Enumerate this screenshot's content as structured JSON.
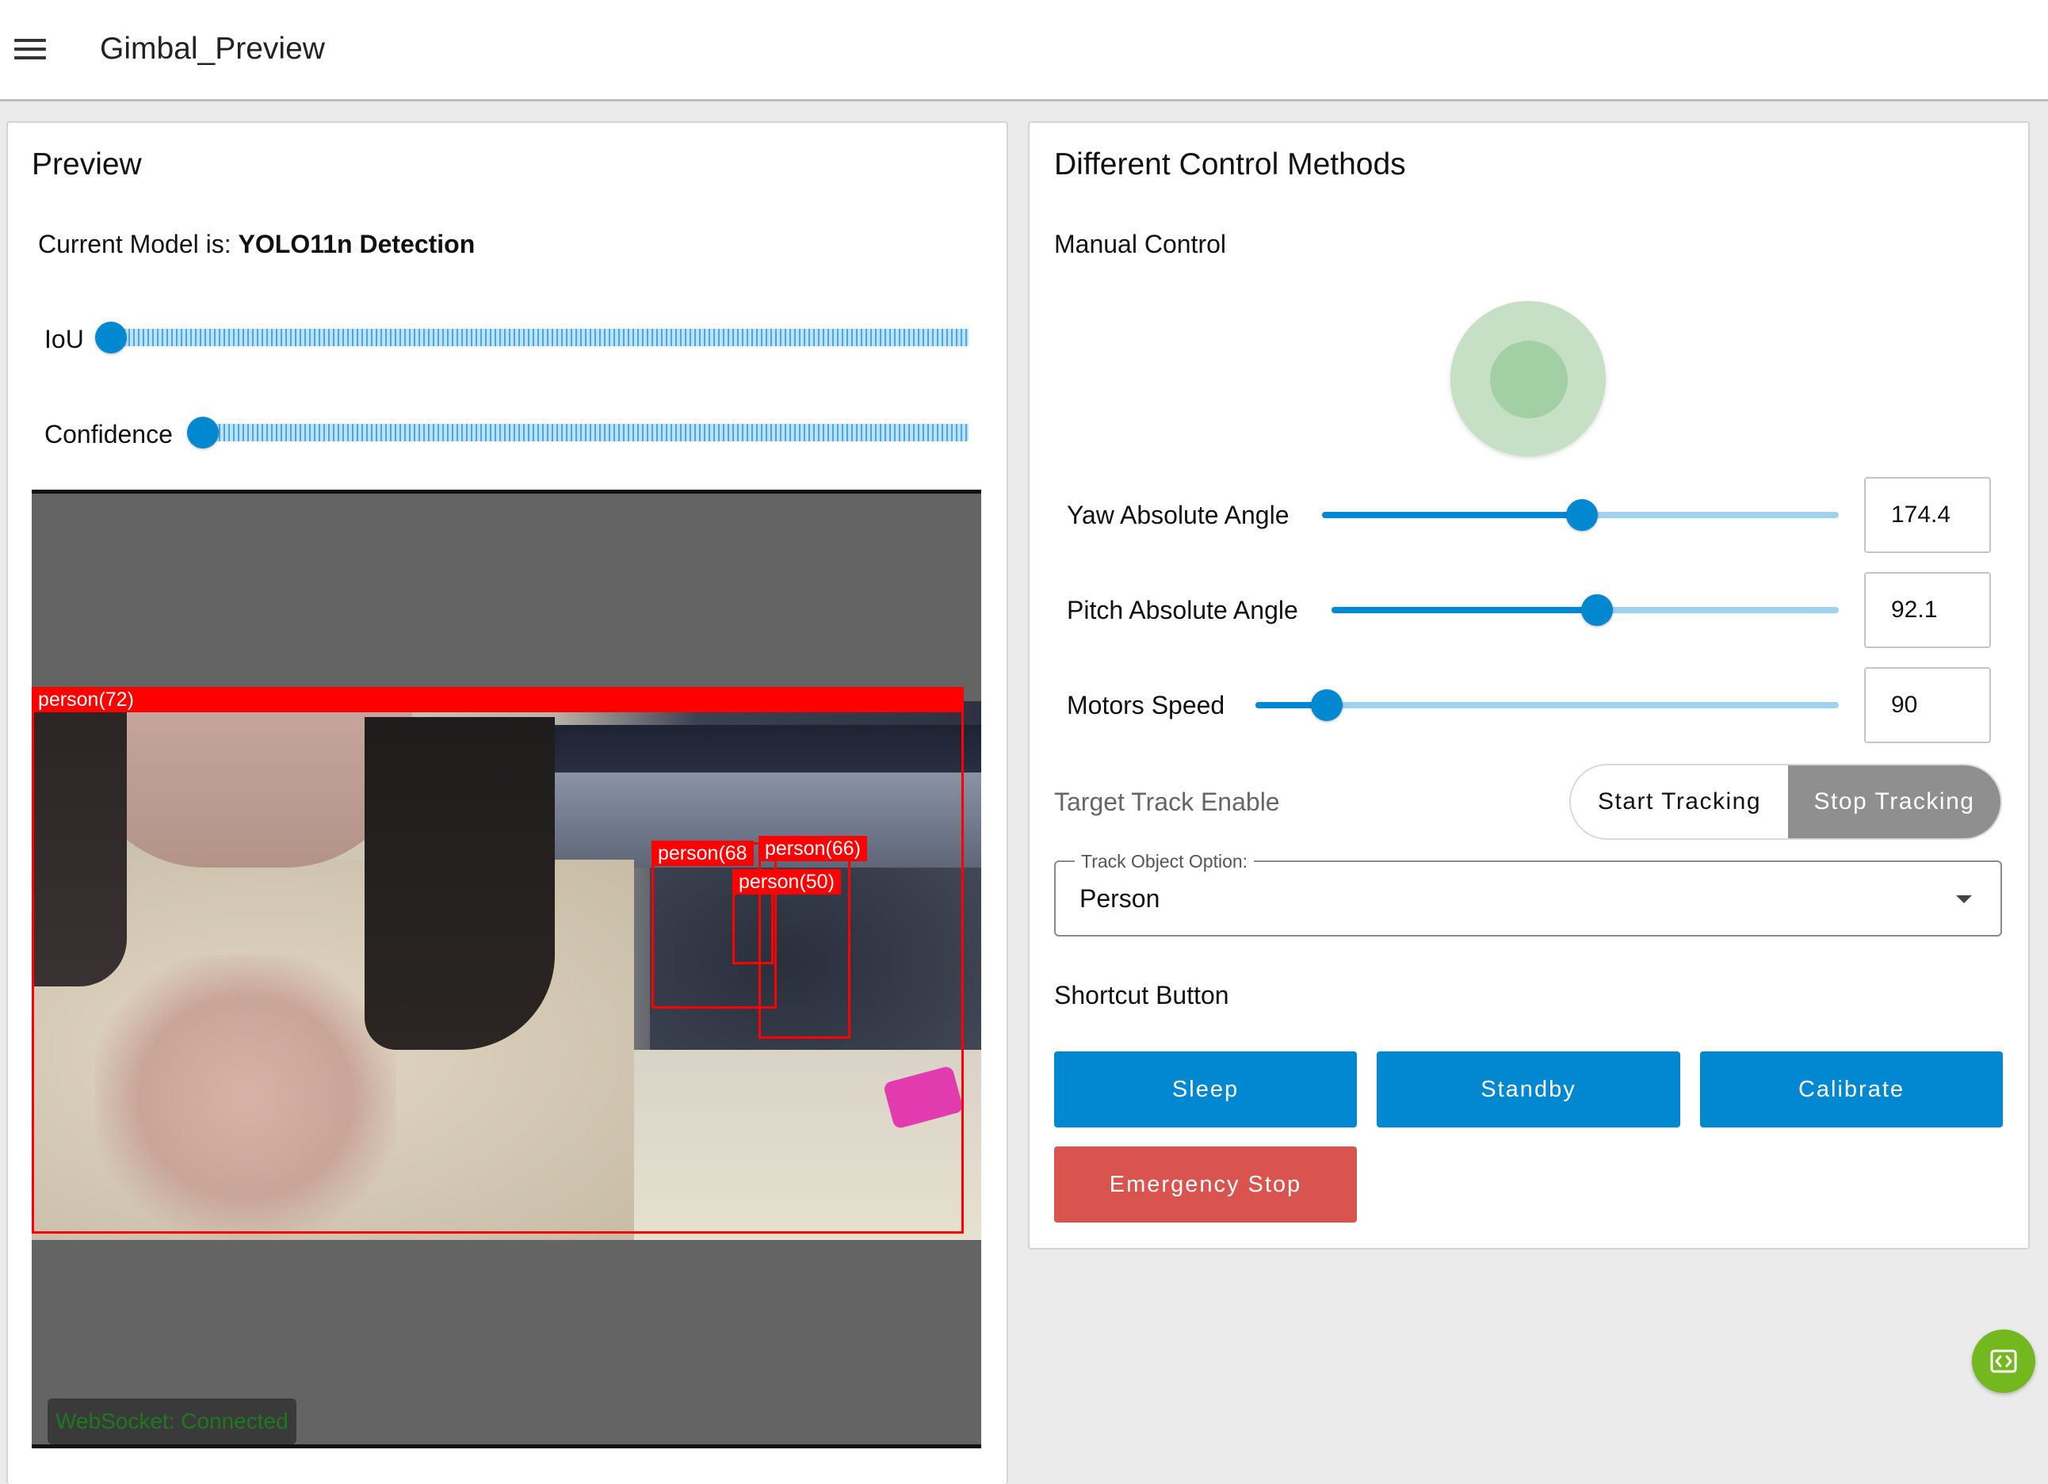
{
  "app": {
    "title": "Gimbal_Preview",
    "menu_icon": "hamburger-menu-icon"
  },
  "preview": {
    "title": "Preview",
    "model_prefix": "Current Model is: ",
    "model_name": "YOLO11n Detection",
    "sliders": [
      {
        "label": "IoU",
        "value_fraction": 0.0
      },
      {
        "label": "Confidence",
        "value_fraction": 0.0
      }
    ],
    "detections": [
      {
        "label": "person(72)"
      },
      {
        "label": "person(68"
      },
      {
        "label": "person(66)"
      },
      {
        "label": "person(50)"
      }
    ],
    "websocket_status": "WebSocket: Connected"
  },
  "control": {
    "title": "Different Control Methods",
    "manual_label": "Manual Control",
    "sliders": [
      {
        "label": "Yaw Absolute Angle",
        "value": "174.4",
        "fraction": 0.5
      },
      {
        "label": "Pitch Absolute Angle",
        "value": "92.1",
        "fraction": 0.52
      },
      {
        "label": "Motors Speed",
        "value": "90",
        "fraction": 0.12
      }
    ],
    "track_enable_label": "Target Track Enable",
    "start_tracking": "Start Tracking",
    "stop_tracking": "Stop Tracking",
    "active_tracking_state": "Stop Tracking",
    "track_option_legend": "Track Object Option:",
    "track_option_value": "Person",
    "shortcut_label": "Shortcut Button",
    "buttons": {
      "sleep": "Sleep",
      "standby": "Standby",
      "calibrate": "Calibrate",
      "emergency_stop": "Emergency Stop"
    }
  },
  "colors": {
    "primary": "#0288d1",
    "danger": "#d9534f",
    "detection": "#ff0000",
    "joystick": "#c5e0c4",
    "fab": "#72b81e"
  }
}
